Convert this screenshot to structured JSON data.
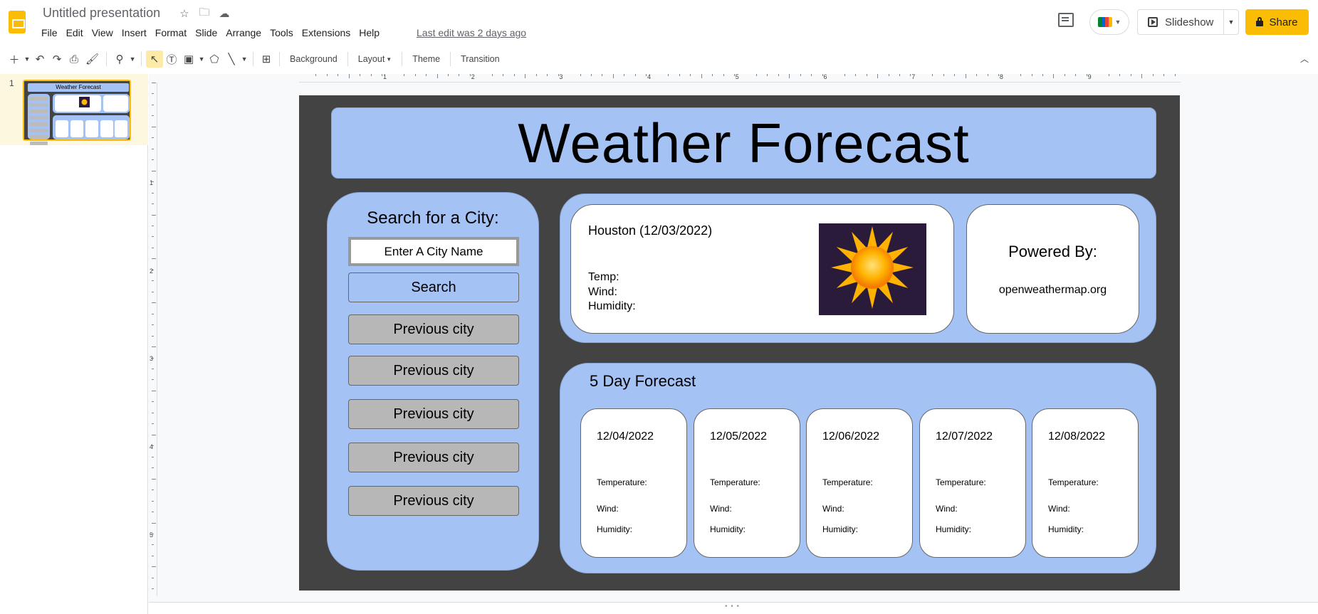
{
  "app": {
    "doc_title": "Untitled presentation",
    "last_edit": "Last edit was 2 days ago",
    "menus": [
      "File",
      "Edit",
      "View",
      "Insert",
      "Format",
      "Slide",
      "Arrange",
      "Tools",
      "Extensions",
      "Help"
    ],
    "slideshow_label": "Slideshow",
    "share_label": "Share",
    "brand_color": "#fbbc04"
  },
  "toolbar": {
    "background_label": "Background",
    "layout_label": "Layout",
    "theme_label": "Theme",
    "transition_label": "Transition"
  },
  "ruler": {
    "h_numbers": [
      "1",
      "2",
      "3",
      "4",
      "5",
      "6",
      "7",
      "8",
      "9"
    ],
    "v_numbers": [
      "1",
      "2",
      "3",
      "4",
      "5"
    ]
  },
  "filmstrip": {
    "slide_number": "1",
    "thumb_title": "Weather Forecast"
  },
  "slide": {
    "title": "Weather Forecast",
    "search": {
      "label": "Search for a City:",
      "input_placeholder": "Enter A City Name",
      "button": "Search"
    },
    "previous_cities": [
      "Previous city",
      "Previous city",
      "Previous city",
      "Previous city",
      "Previous city"
    ],
    "current": {
      "city_date": "Houston (12/03/2022)",
      "temp_label": "Temp:",
      "wind_label": "Wind:",
      "humidity_label": "Humidity:"
    },
    "powered": {
      "label": "Powered By:",
      "source": "openweathermap.org"
    },
    "forecast": {
      "title": "5 Day Forecast",
      "days": [
        {
          "date": "12/04/2022",
          "temp": "Temperature:",
          "wind": "Wind:",
          "humidity": "Humidity:"
        },
        {
          "date": "12/05/2022",
          "temp": "Temperature:",
          "wind": "Wind:",
          "humidity": "Humidity:"
        },
        {
          "date": "12/06/2022",
          "temp": "Temperature:",
          "wind": "Wind:",
          "humidity": "Humidity:"
        },
        {
          "date": "12/07/2022",
          "temp": "Temperature:",
          "wind": "Wind:",
          "humidity": "Humidity:"
        },
        {
          "date": "12/08/2022",
          "temp": "Temperature:",
          "wind": "Wind:",
          "humidity": "Humidity:"
        }
      ]
    },
    "colors": {
      "panel_blue": "#a4c2f4",
      "slide_bg": "#434343",
      "prev_button_gray": "#b7b7b7"
    }
  }
}
